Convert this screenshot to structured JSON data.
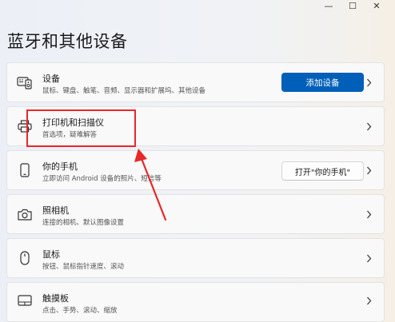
{
  "window": {
    "minimize_glyph": "—",
    "maximize_glyph": "☐",
    "close_glyph": "✕"
  },
  "page": {
    "title": "蓝牙和其他设备"
  },
  "cards": [
    {
      "title": "设备",
      "subtitle": "鼠标、键盘、触笔、音频、显示器和扩展坞、其他设备",
      "icon": "devices-icon",
      "button_label": "添加设备"
    },
    {
      "title": "打印机和扫描仪",
      "subtitle": "首选项，疑难解答",
      "icon": "printer-icon"
    },
    {
      "title": "你的手机",
      "subtitle": "立即访问 Android 设备的照片、短信等",
      "icon": "phone-icon",
      "button_label": "打开\"你的手机\""
    },
    {
      "title": "照相机",
      "subtitle": "连接的相机、默认图像设置",
      "icon": "camera-icon"
    },
    {
      "title": "鼠标",
      "subtitle": "按钮、鼠标指针速度、滚动",
      "icon": "mouse-icon"
    },
    {
      "title": "触摸板",
      "subtitle": "点击、手势、滚动、缩放",
      "icon": "touchpad-icon"
    }
  ],
  "annotation": {
    "color": "#e8282a"
  },
  "colors": {
    "accent": "#005fb8"
  }
}
